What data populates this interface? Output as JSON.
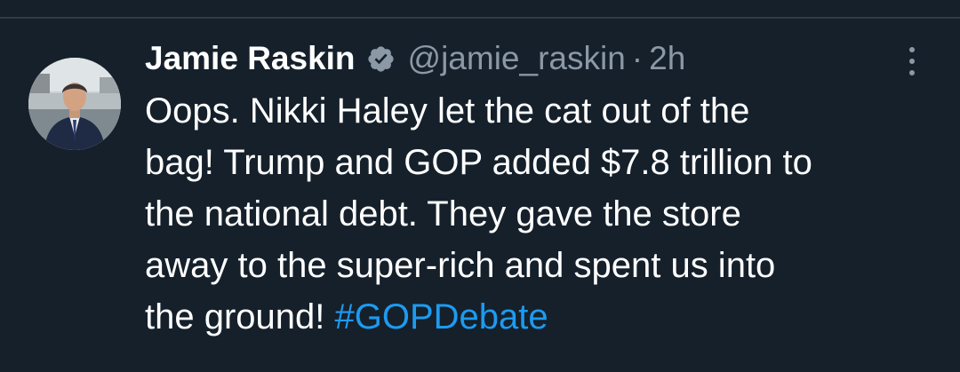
{
  "tweet": {
    "author_name": "Jamie Raskin",
    "handle": "@jamie_raskin",
    "separator": "·",
    "time": "2h",
    "verified_badge_color": "#8b98a5",
    "text_lines": [
      "Oops. Nikki Haley let the cat out of the",
      "bag! Trump and GOP added $7.8 trillion to",
      "the national debt. They gave the store",
      "away to the super-rich and spent us into",
      "the ground! "
    ],
    "hashtag": "#GOPDebate",
    "hashtag_color": "#1d9bf0",
    "more_icon": "more-vertical-icon"
  },
  "theme": {
    "background": "#15202b",
    "text": "#ffffff",
    "muted": "#8b98a5"
  }
}
